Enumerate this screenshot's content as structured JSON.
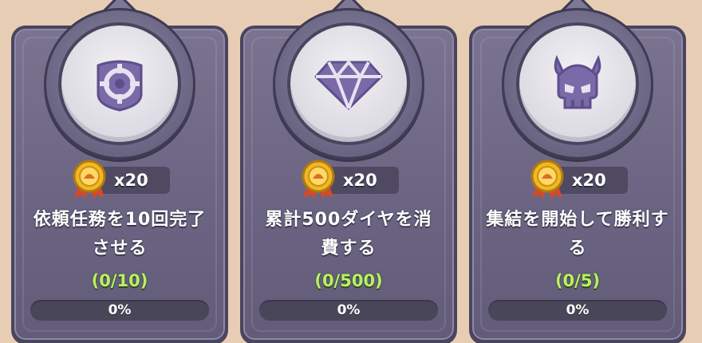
{
  "quests": [
    {
      "icon": "target-emblem-icon",
      "reward_qty": "x20",
      "title": "依頼任務を10回完了させる",
      "count": "(0/10)",
      "progress_label": "0%",
      "progress": 0
    },
    {
      "icon": "diamond-icon",
      "reward_qty": "x20",
      "title": "累計500ダイヤを消費する",
      "count": "(0/500)",
      "progress_label": "0%",
      "progress": 0
    },
    {
      "icon": "horned-skull-icon",
      "reward_qty": "x20",
      "title": "集結を開始して勝利する",
      "count": "(0/5)",
      "progress_label": "0%",
      "progress": 0
    }
  ],
  "colors": {
    "background": "#e8cdb5",
    "card": "#6b6583",
    "icon": "#7a6aa8",
    "count_text": "#b8f06a",
    "medal_gold": "#f2b824"
  }
}
